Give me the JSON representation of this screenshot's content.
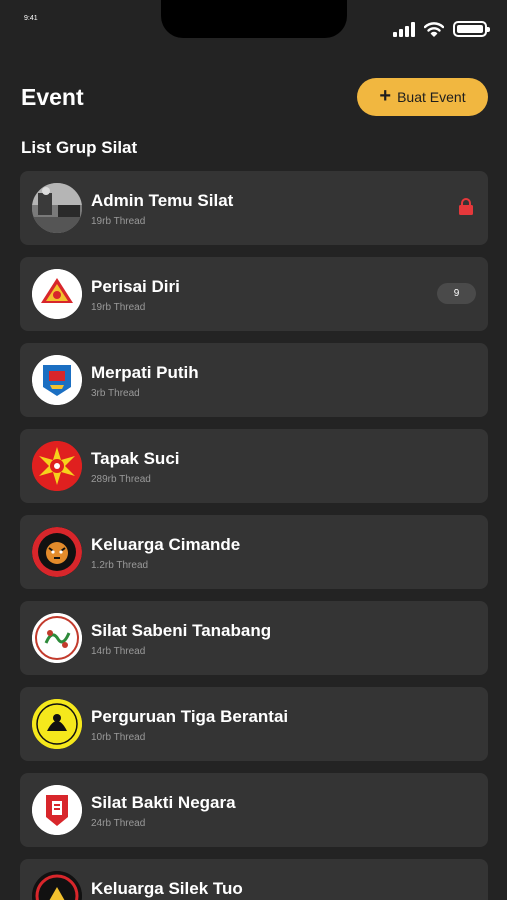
{
  "status_bar": {
    "time": "9:41"
  },
  "header": {
    "title": "Event",
    "create_button_label": "Buat Event"
  },
  "section": {
    "title": "List Grup Silat"
  },
  "groups": [
    {
      "name": "Admin Temu Silat",
      "threads": "19rb Thread",
      "icon": "photo-avatar",
      "locked": true
    },
    {
      "name": "Perisai Diri",
      "threads": "19rb Thread",
      "icon": "perisai-diri-logo",
      "badge": "9"
    },
    {
      "name": "Merpati Putih",
      "threads": "3rb Thread",
      "icon": "merpati-putih-logo"
    },
    {
      "name": "Tapak Suci",
      "threads": "289rb Thread",
      "icon": "tapak-suci-logo"
    },
    {
      "name": "Keluarga Cimande",
      "threads": "1.2rb Thread",
      "icon": "cimande-tiger-logo"
    },
    {
      "name": "Silat Sabeni Tanabang",
      "threads": "14rb Thread",
      "icon": "sabeni-logo"
    },
    {
      "name": "Perguruan Tiga Berantai",
      "threads": "10rb Thread",
      "icon": "tiga-berantai-logo"
    },
    {
      "name": "Silat Bakti Negara",
      "threads": "24rb Thread",
      "icon": "bakti-negara-logo"
    },
    {
      "name": "Keluarga Silek Tuo",
      "threads": "",
      "icon": "silek-tuo-logo"
    }
  ],
  "colors": {
    "background": "#232323",
    "card": "#343434",
    "accent": "#F1B740",
    "lock": "#E5383B"
  }
}
